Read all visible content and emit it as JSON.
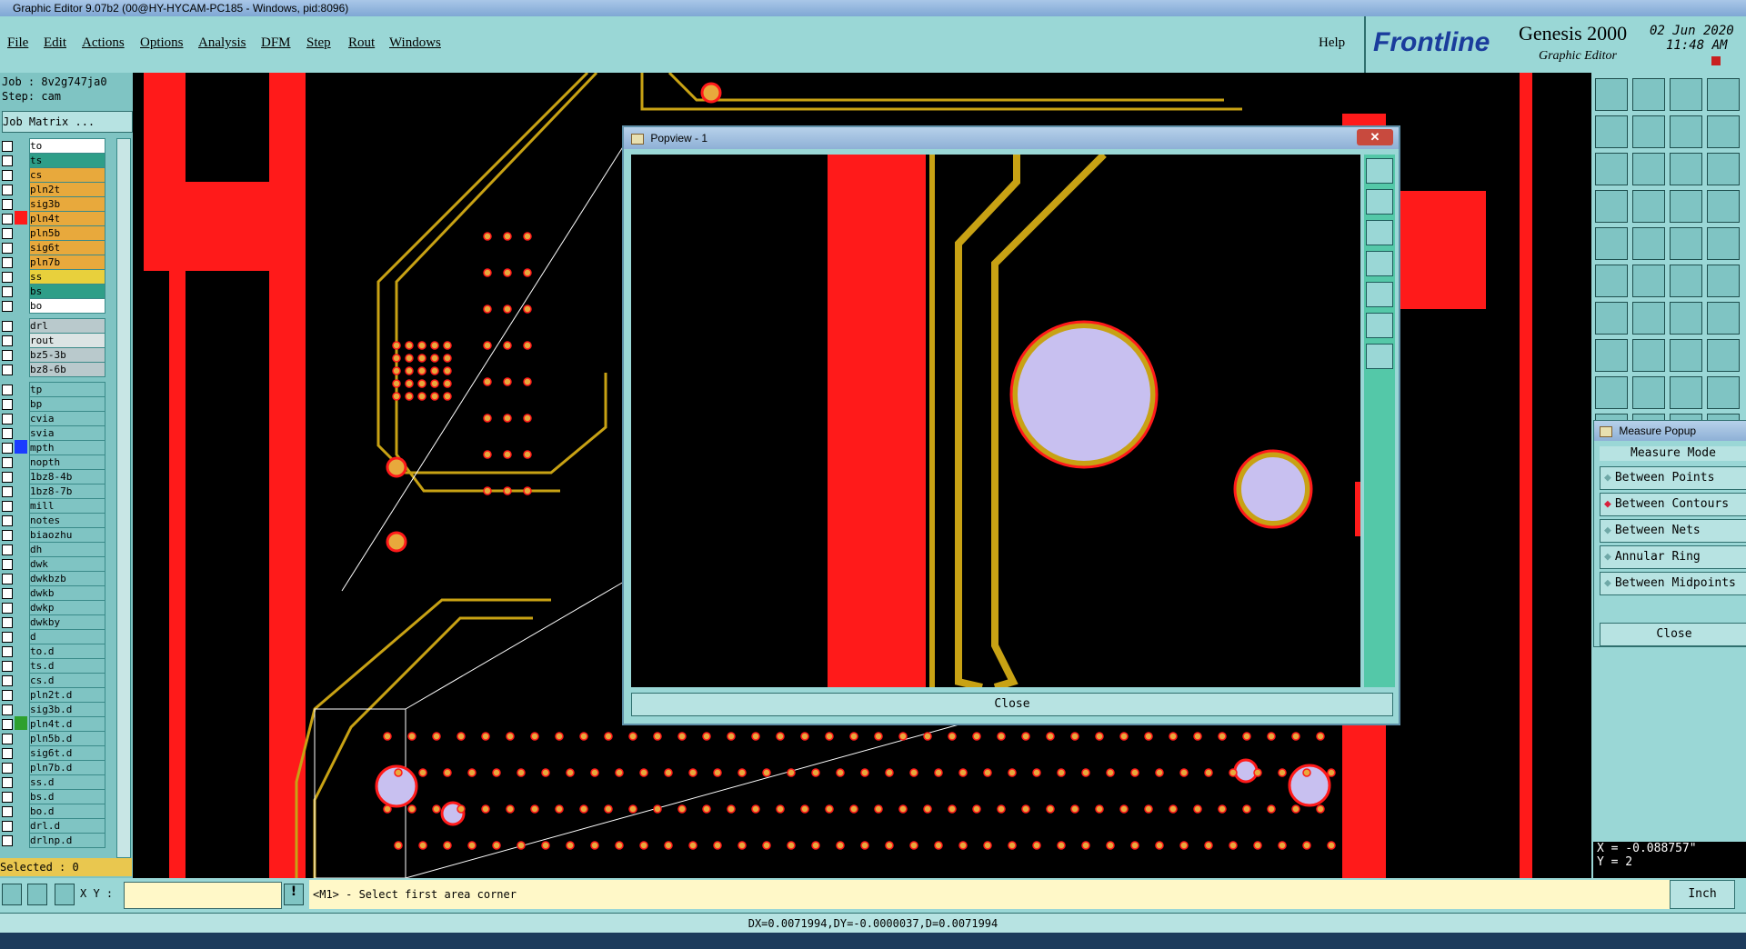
{
  "window": {
    "title": "Graphic Editor 9.07b2 (00@HY-HYCAM-PC185 - Windows, pid:8096)"
  },
  "menu": [
    "File",
    "Edit",
    "Actions",
    "Options",
    "Analysis",
    "DFM",
    "Step",
    "Rout",
    "Windows"
  ],
  "help": "Help",
  "brand": {
    "logo": "Frontline",
    "product": "Genesis 2000",
    "subtitle": "Graphic Editor",
    "date": "02 Jun 2020",
    "time": "11:48 AM"
  },
  "left": {
    "job": "Job : 8v2g747ja0",
    "step": "Step: cam",
    "job_matrix": "Job Matrix ...",
    "layers": [
      {
        "name": "to",
        "color": "#ffffff"
      },
      {
        "name": "ts",
        "color": "#2e9e88"
      },
      {
        "name": "cs",
        "color": "#e8a93c"
      },
      {
        "name": "pln2t",
        "color": "#e8a93c"
      },
      {
        "name": "sig3b",
        "color": "#e8a93c"
      },
      {
        "name": "pln4t",
        "color": "#e8a93c",
        "active": "#ff1a1a"
      },
      {
        "name": "pln5b",
        "color": "#e8a93c"
      },
      {
        "name": "sig6t",
        "color": "#e8a93c"
      },
      {
        "name": "pln7b",
        "color": "#e8a93c"
      },
      {
        "name": "ss",
        "color": "#e8d03c"
      },
      {
        "name": "bs",
        "color": "#2e9e88"
      },
      {
        "name": "bo",
        "color": "#ffffff"
      },
      {
        "name": "drl",
        "color": "#b9c9cc",
        "gap": true
      },
      {
        "name": "rout",
        "color": "#dce4e4"
      },
      {
        "name": "bz5-3b",
        "color": "#b9c9cc"
      },
      {
        "name": "bz8-6b",
        "color": "#b9c9cc"
      },
      {
        "name": "tp",
        "color": "#7fc4c3",
        "gap": true
      },
      {
        "name": "bp",
        "color": "#7fc4c3"
      },
      {
        "name": "cvia",
        "color": "#7fc4c3"
      },
      {
        "name": "svia",
        "color": "#7fc4c3"
      },
      {
        "name": "mpth",
        "color": "#7fc4c3",
        "active": "#1a3cff"
      },
      {
        "name": "nopth",
        "color": "#7fc4c3"
      },
      {
        "name": "1bz8-4b",
        "color": "#7fc4c3"
      },
      {
        "name": "1bz8-7b",
        "color": "#7fc4c3"
      },
      {
        "name": "mill",
        "color": "#7fc4c3"
      },
      {
        "name": "notes",
        "color": "#7fc4c3"
      },
      {
        "name": "biaozhu",
        "color": "#7fc4c3"
      },
      {
        "name": "dh",
        "color": "#7fc4c3"
      },
      {
        "name": "dwk",
        "color": "#7fc4c3"
      },
      {
        "name": "dwkbzb",
        "color": "#7fc4c3"
      },
      {
        "name": "dwkb",
        "color": "#7fc4c3"
      },
      {
        "name": "dwkp",
        "color": "#7fc4c3"
      },
      {
        "name": "dwkby",
        "color": "#7fc4c3"
      },
      {
        "name": "d",
        "color": "#7fc4c3"
      },
      {
        "name": "to.d",
        "color": "#7fc4c3"
      },
      {
        "name": "ts.d",
        "color": "#7fc4c3"
      },
      {
        "name": "cs.d",
        "color": "#7fc4c3"
      },
      {
        "name": "pln2t.d",
        "color": "#7fc4c3"
      },
      {
        "name": "sig3b.d",
        "color": "#7fc4c3"
      },
      {
        "name": "pln4t.d",
        "color": "#7fc4c3",
        "active": "#2ea02e"
      },
      {
        "name": "pln5b.d",
        "color": "#7fc4c3"
      },
      {
        "name": "sig6t.d",
        "color": "#7fc4c3"
      },
      {
        "name": "pln7b.d",
        "color": "#7fc4c3"
      },
      {
        "name": "ss.d",
        "color": "#7fc4c3"
      },
      {
        "name": "bs.d",
        "color": "#7fc4c3"
      },
      {
        "name": "bo.d",
        "color": "#7fc4c3"
      },
      {
        "name": "drl.d",
        "color": "#7fc4c3"
      },
      {
        "name": "drlnp.d",
        "color": "#7fc4c3"
      }
    ],
    "selected": "Selected : 0"
  },
  "popview": {
    "title": "Popview - 1",
    "close_label": "Close"
  },
  "measure": {
    "title": "Measure Popup",
    "mode_label": "Measure Mode",
    "options": [
      "Between Points",
      "Between Contours",
      "Between Nets",
      "Annular Ring",
      "Between Midpoints"
    ],
    "selected": "Between Contours",
    "close_label": "Close"
  },
  "bottom": {
    "xy_label": "X Y :",
    "prompt": "<M1> - Select first area corner",
    "units": "Inch",
    "status": "DX=0.0071994,DY=-0.0000037,D=0.0071994",
    "coord_x": "X = -0.088757\"",
    "coord_y": "Y = 2"
  },
  "colors": {
    "copper": "#c8a214",
    "red": "#ff1a1a",
    "pad": "#c8c0f0",
    "panel": "#9ad7d6"
  }
}
